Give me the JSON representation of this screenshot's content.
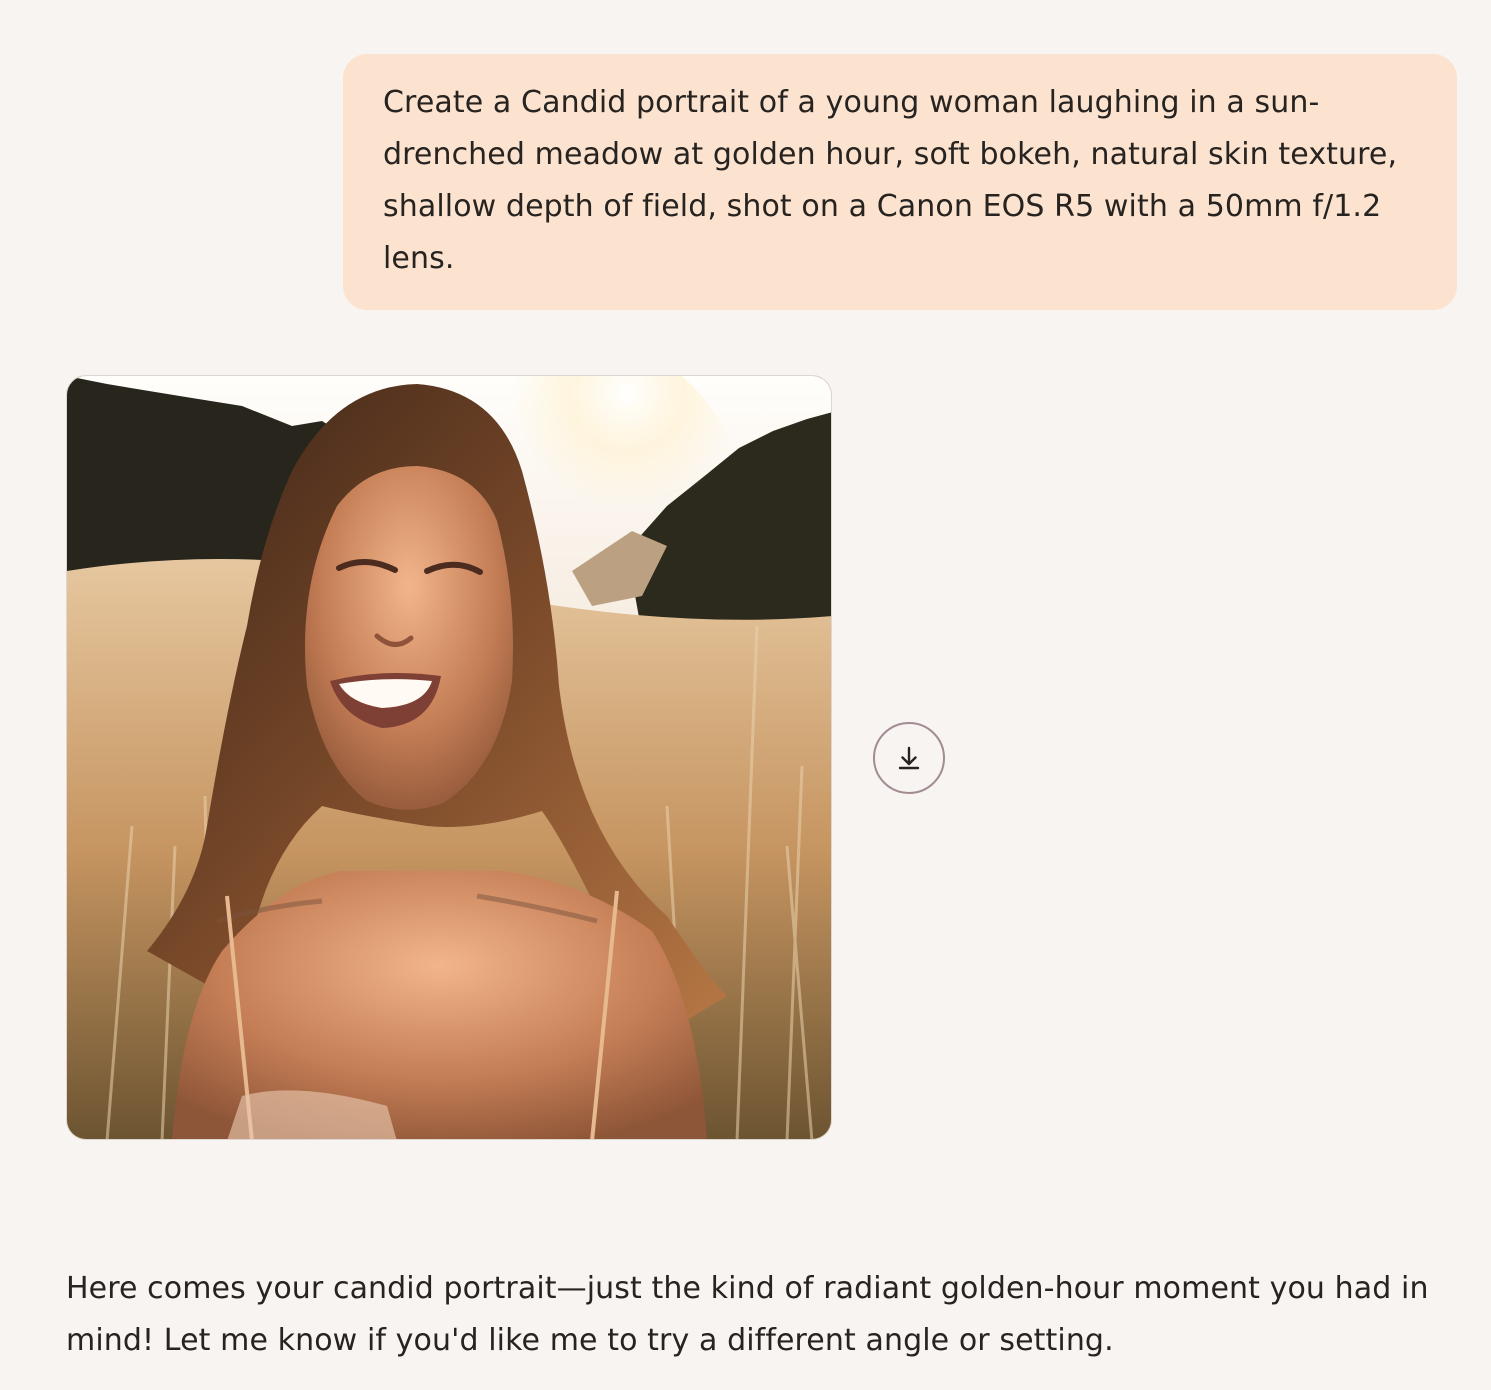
{
  "conversation": {
    "user_message": "Create a Candid portrait of a young woman laughing in a sun-drenched meadow at golden hour, soft bokeh, natural skin texture, shallow depth of field, shot on a Canon EOS R5 with a 50mm f/1.2 lens.",
    "assistant_message": "Here comes your candid portrait—just the kind of radiant golden-hour moment you had in mind! Let me know if you'd like me to try a different angle or setting."
  },
  "generated_image": {
    "icon": "photo-placeholder",
    "accent_colors": [
      "#f7eee3",
      "#d8aa78",
      "#5a3a24",
      "#27251c"
    ]
  },
  "actions": {
    "download_icon": "download-icon"
  },
  "colors": {
    "page_background": "#f8f4f1",
    "user_bubble": "#fbe3cf",
    "text": "#272320",
    "download_border": "#a08c92"
  }
}
